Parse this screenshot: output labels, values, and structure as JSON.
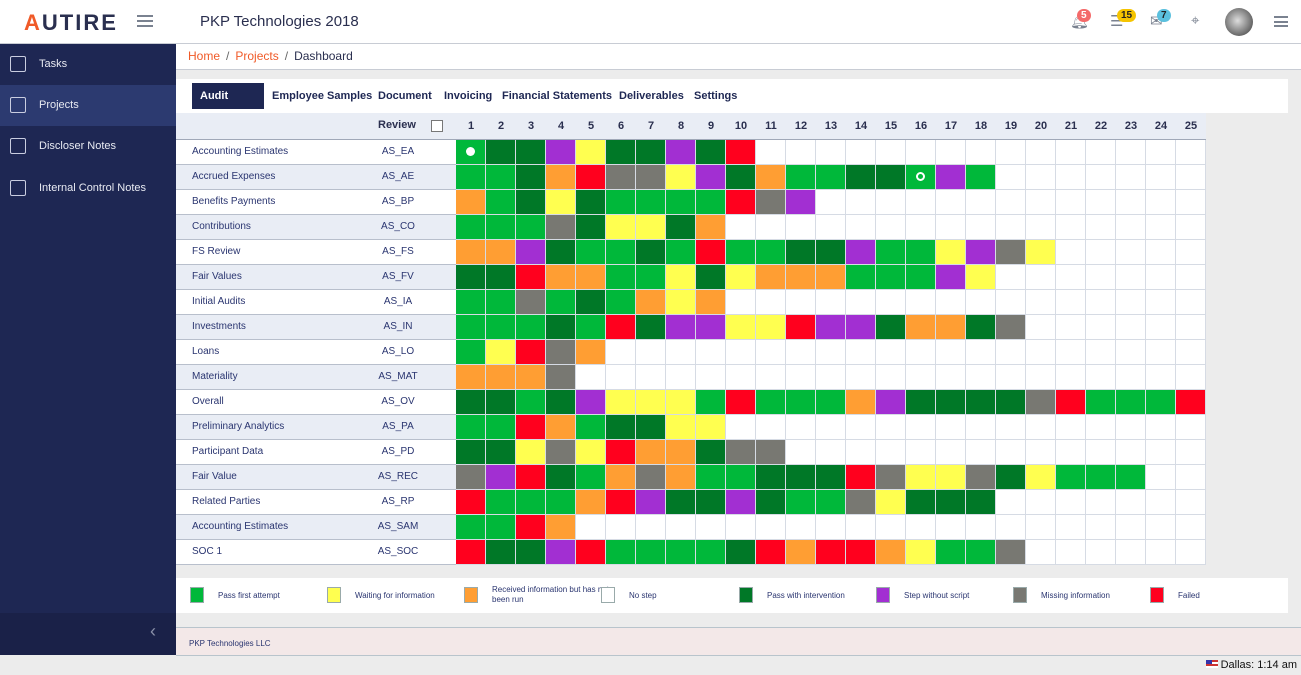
{
  "header": {
    "logo": "AUTIRE",
    "title": "PKP Technologies 2018",
    "notifications": "5",
    "tasks": "15",
    "messages": "7"
  },
  "sidebar": {
    "items": [
      {
        "label": "Tasks",
        "icon": "clipboard-icon"
      },
      {
        "label": "Projects",
        "icon": "folder-icon",
        "active": true
      },
      {
        "label": "Discloser Notes",
        "icon": "notes-icon"
      },
      {
        "label": "Internal Control Notes",
        "icon": "document-icon"
      }
    ]
  },
  "breadcrumb": [
    "Home",
    "Projects",
    "Dashboard"
  ],
  "tabs": [
    "Audit Steps",
    "Employee Samples",
    "Document",
    "Invoicing",
    "Financial Statements",
    "Deliverables",
    "Settings"
  ],
  "grid": {
    "review_label": "Review",
    "columns": [
      "1",
      "2",
      "3",
      "4",
      "5",
      "6",
      "7",
      "8",
      "9",
      "10",
      "11",
      "12",
      "13",
      "14",
      "15",
      "16",
      "17",
      "18",
      "19",
      "20",
      "21",
      "22",
      "23",
      "24",
      "25"
    ],
    "rows": [
      {
        "name": "Accounting Estimates",
        "code": "AS_EA",
        "cells": "GDDPYDDPDRWWWWWWWWWWWWWWW",
        "marker": {
          "col": 1,
          "type": "dot"
        }
      },
      {
        "name": "Accrued Expenses",
        "code": "AS_AE",
        "cells": "GGDORMMYPDOGGDDGPGWWWWWWW",
        "marker": {
          "col": 16,
          "type": "ring"
        }
      },
      {
        "name": "Benefits Payments",
        "code": "AS_BP",
        "cells": "OGDYDGGGGRMPWWWWWWWWWWWWW"
      },
      {
        "name": "Contributions",
        "code": "AS_CO",
        "cells": "GGGMDYYDOWWWWWWWWWWWWWWWW"
      },
      {
        "name": "FS Review",
        "code": "AS_FS",
        "cells": "OOPDGGDGRGGDDPGGYPMYWWWWW"
      },
      {
        "name": "Fair Values",
        "code": "AS_FV",
        "cells": "DDROOGGYDYOOOGGGPYWWWWWWW"
      },
      {
        "name": "Initial Audits",
        "code": "AS_IA",
        "cells": "GGMGDGOYOWWWWWWWWWWWWWWWW"
      },
      {
        "name": "Investments",
        "code": "AS_IN",
        "cells": "GGGDGRDPPYYRPPDOODMWWWWWW"
      },
      {
        "name": "Loans",
        "code": "AS_LO",
        "cells": "GYRMOWWWWWWWWWWWWWWWWWWWW"
      },
      {
        "name": "Materiality",
        "code": "AS_MAT",
        "cells": "OOOMWWWWWWWWWWWWWWWWWWWWW"
      },
      {
        "name": "Overall",
        "code": "AS_OV",
        "cells": "DDGDPYYYGRGGGOPDDDDMRGGGR"
      },
      {
        "name": "Preliminary Analytics",
        "code": "AS_PA",
        "cells": "GGROGDDYYWWWWWWWWWWWWWWWW"
      },
      {
        "name": "Participant Data",
        "code": "AS_PD",
        "cells": "DDYMYROODMMWWWWWWWWWWWWWW"
      },
      {
        "name": "Fair Value",
        "code": "AS_REC",
        "cells": "MPRDGOMOGGDDDRMYYMDYGGGWW"
      },
      {
        "name": "Related Parties",
        "code": "AS_RP",
        "cells": "RGGGORPDDPDGGMYDDDWWWWWWW"
      },
      {
        "name": "Accounting Estimates",
        "code": "AS_SAM",
        "cells": "GGROWWWWWWWWWWWWWWWWWWWWW"
      },
      {
        "name": "SOC 1",
        "code": "AS_SOC",
        "cells": "RDDPRGGGGDRORROYGGMWWWWWW"
      }
    ]
  },
  "legend": [
    {
      "key": "G",
      "label": "Pass first attempt",
      "color": "#00b83a"
    },
    {
      "key": "Y",
      "label": "Waiting for information",
      "color": "#ffff50"
    },
    {
      "key": "O",
      "label": "Received information but has not been run",
      "color": "#ff9e33"
    },
    {
      "key": "W",
      "label": "No step",
      "color": "#ffffff"
    },
    {
      "key": "D",
      "label": "Pass with intervention",
      "color": "#007827"
    },
    {
      "key": "P",
      "label": "Step without script",
      "color": "#a22fd2"
    },
    {
      "key": "M",
      "label": "Missing information",
      "color": "#787872"
    },
    {
      "key": "R",
      "label": "Failed",
      "color": "#ff001e"
    }
  ],
  "footer": {
    "company": "PKP Technologies LLC"
  },
  "status": {
    "clock": "Dallas: 1:14 am"
  }
}
